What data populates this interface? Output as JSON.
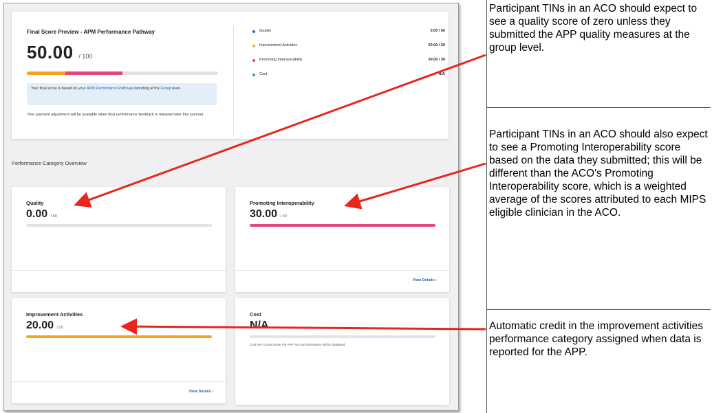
{
  "final_score": {
    "title": "Final Score Preview - APM Performance Pathway",
    "score": "50.00",
    "out_of": "/ 100",
    "bar_fraction": 0.5,
    "bar_segments": [
      {
        "category": "Improvement Activities",
        "points": 20,
        "color": "#f5a524"
      },
      {
        "category": "Promoting Interoperability",
        "points": 30,
        "color": "#e64582"
      }
    ],
    "note_prefix": "Your final score is based on your ",
    "note_link1": "APM Performance Pathway",
    "note_mid": " reporting at the ",
    "note_link2": "Group",
    "note_suffix": " level.",
    "footer": "Your payment adjustment will be available when final performance feedback is released later this summer",
    "legend": [
      {
        "label": "Quality",
        "value": "0.00 / 50",
        "color": "#1a73c9"
      },
      {
        "label": "Improvement Activities",
        "value": "20.00 / 20",
        "color": "#f5a524"
      },
      {
        "label": "Promoting Interoperability",
        "value": "30.00 / 30",
        "color": "#e64582"
      },
      {
        "label": "Cost",
        "value": "N/A",
        "color": "#2ea84a"
      }
    ]
  },
  "overview": {
    "section_title": "Performance Category Overview",
    "quality": {
      "title": "Quality",
      "score": "0.00",
      "out_of": "/ 50",
      "fraction": 0
    },
    "promoting_interoperability": {
      "title": "Promoting Interoperability",
      "score": "30.00",
      "out_of": "/ 30",
      "fraction": 1,
      "view_details": "View Details"
    },
    "improvement_activities": {
      "title": "Improvement Activities",
      "score": "20.00",
      "out_of": "/ 20",
      "fraction": 1,
      "view_details": "View Details"
    },
    "cost": {
      "title": "Cost",
      "score": "N/A",
      "fraction": 0,
      "note": "Cost isn't scored under the APP. No cost information will be displayed."
    }
  },
  "annotations": [
    "Participant TINs in an ACO should expect to see a quality score of zero unless they submitted the APP quality measures at the group level.",
    "Participant TINs in an ACO should also expect to see a Promoting Interoperability score based on the data they submitted; this will be different than the ACO's Promoting Interoperability score, which is a weighted average of the scores attributed to each MIPS eligible clinician in the ACO.",
    "Automatic credit in the improvement activities performance category assigned when data is reported for the APP."
  ],
  "colors": {
    "arrow": "#e8261e",
    "link": "#1a5fb4",
    "quality": "#1a73c9",
    "ia": "#f5a524",
    "pi": "#e64582",
    "cost": "#2ea84a"
  }
}
